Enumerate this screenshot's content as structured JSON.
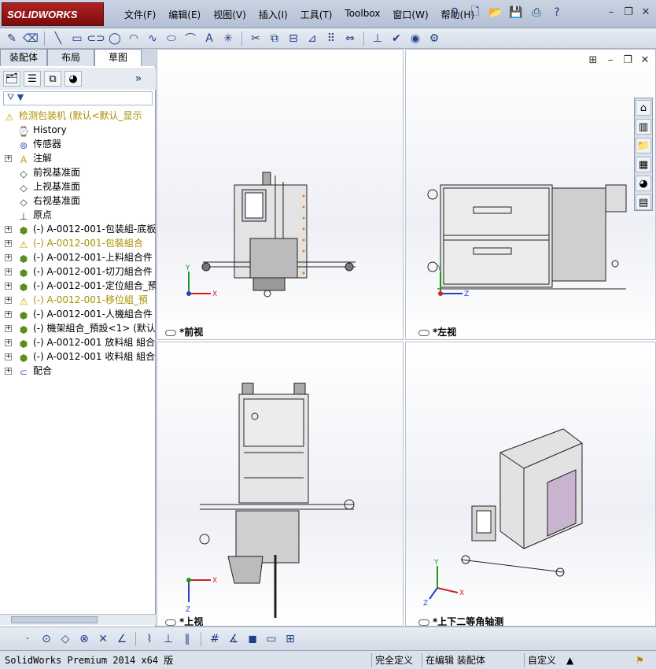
{
  "app": {
    "logo_text": "SOLIDWORKS",
    "menu": [
      "文件(F)",
      "编辑(E)",
      "视图(V)",
      "插入(I)",
      "工具(T)",
      "Toolbox",
      "窗口(W)",
      "帮助(H)"
    ]
  },
  "title_icons": [
    "pin-icon",
    "new-document-icon",
    "open-icon",
    "save-icon",
    "print-icon",
    "help-icon"
  ],
  "window_controls": [
    "minimize",
    "restore",
    "close"
  ],
  "left_panel": {
    "tabs": [
      "装配体",
      "布局",
      "草图"
    ],
    "active_tab": "草图",
    "filter_glyph": "▼"
  },
  "tree": [
    {
      "label": "检测包装机  (默认<默认_显示",
      "icon": "assembly-warning",
      "indent": 0,
      "expand": false,
      "warn": true
    },
    {
      "label": "History",
      "icon": "history",
      "indent": 1,
      "expand": false
    },
    {
      "label": "传感器",
      "icon": "sensor",
      "indent": 1,
      "expand": false
    },
    {
      "label": "注解",
      "icon": "annotation",
      "indent": 1,
      "expand": true
    },
    {
      "label": "前视基准面",
      "icon": "plane",
      "indent": 1,
      "expand": false
    },
    {
      "label": "上视基准面",
      "icon": "plane",
      "indent": 1,
      "expand": false
    },
    {
      "label": "右视基准面",
      "icon": "plane",
      "indent": 1,
      "expand": false
    },
    {
      "label": "原点",
      "icon": "origin",
      "indent": 1,
      "expand": false
    },
    {
      "label": "(-) A-0012-001-包装組-底板",
      "icon": "subassembly",
      "indent": 1,
      "expand": true
    },
    {
      "label": "(-) A-0012-001-包裝組合",
      "icon": "subassembly-warning",
      "indent": 1,
      "expand": true,
      "warn": true
    },
    {
      "label": "(-) A-0012-001-上料組合件",
      "icon": "subassembly",
      "indent": 1,
      "expand": true
    },
    {
      "label": "(-) A-0012-001-切刀組合件",
      "icon": "subassembly",
      "indent": 1,
      "expand": true
    },
    {
      "label": "(-) A-0012-001-定位組合_預",
      "icon": "subassembly",
      "indent": 1,
      "expand": true
    },
    {
      "label": "(-) A-0012-001-移位組_預",
      "icon": "subassembly-warning",
      "indent": 1,
      "expand": true,
      "warn": true
    },
    {
      "label": "(-) A-0012-001-人機組合件",
      "icon": "subassembly",
      "indent": 1,
      "expand": true
    },
    {
      "label": "(-) 機架組合_預設<1> (默认",
      "icon": "subassembly",
      "indent": 1,
      "expand": true
    },
    {
      "label": "(-) A-0012-001 放料組 組合",
      "icon": "subassembly",
      "indent": 1,
      "expand": true
    },
    {
      "label": "(-) A-0012-001 收料組 組合",
      "icon": "subassembly",
      "indent": 1,
      "expand": true
    },
    {
      "label": "配合",
      "icon": "mates",
      "indent": 1,
      "expand": true
    }
  ],
  "views": [
    {
      "label": "*前视",
      "id": "front"
    },
    {
      "label": "*左视",
      "id": "left"
    },
    {
      "label": "*上视",
      "id": "top"
    },
    {
      "label": "*上下二等角轴测",
      "id": "dimetric"
    }
  ],
  "axes": {
    "x": "X",
    "y": "Y",
    "z": "Z"
  },
  "status": {
    "product": "SolidWorks Premium 2014 x64 版",
    "definition": "完全定义",
    "mode": "在编辑 装配体",
    "units": "自定义",
    "arrow": "▲"
  },
  "colors": {
    "accent": "#2753a0",
    "logo_red": "#b22222",
    "warning": "#a88f00"
  }
}
